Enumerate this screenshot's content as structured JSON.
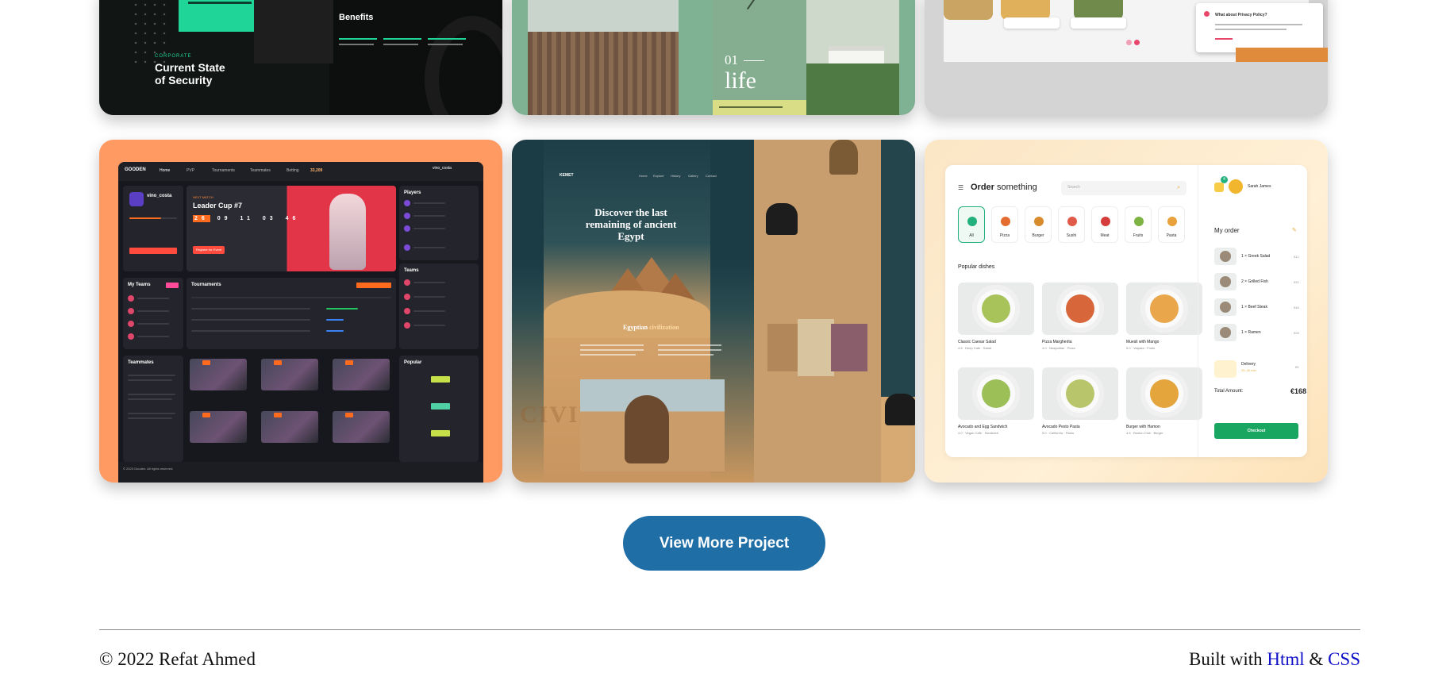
{
  "row1": {
    "security": {
      "hero_text": "Benefits",
      "kicker": "CORPORATE",
      "title_line1": "Current State",
      "title_line2": "of Security"
    },
    "architecture": {
      "number": "01",
      "word": "life"
    },
    "food_privacy": {
      "modal_title": "What about Privacy Policy?"
    }
  },
  "gaming": {
    "logo": "GOODEN",
    "nav": [
      "Home",
      "PVP",
      "Tournaments",
      "Teammates",
      "Betting"
    ],
    "points": "33,209",
    "username": "vino_costa",
    "banner_kicker": "NEXT MATCH",
    "banner_title": "Leader Cup #7",
    "countdown": [
      "26",
      "09",
      "11",
      "03",
      "46"
    ],
    "register": "Register for Event",
    "my_teams": "My Teams",
    "tournaments": "Tournaments",
    "players": "Players",
    "teams": "Teams",
    "teammates": "Teammates",
    "popular": "Popular",
    "footer": "© 2023 Gooden. All rights reserved."
  },
  "egypt": {
    "brand": "KEMET",
    "nav": [
      "Home",
      "Explore",
      "History",
      "Gallery",
      "Contact"
    ],
    "headline": "Discover the last remaining of ancient Egypt",
    "sub_a": "Egyptian",
    "sub_b": "civilization",
    "watermark": "CIVILIZATION"
  },
  "order": {
    "title_bold": "Order",
    "title_rest": "something",
    "search_placeholder": "Search",
    "categories": [
      {
        "label": "All",
        "color": "#22b07d"
      },
      {
        "label": "Pizza",
        "color": "#e46c2f"
      },
      {
        "label": "Burger",
        "color": "#d88b2c"
      },
      {
        "label": "Sushi",
        "color": "#e05a4a"
      },
      {
        "label": "Meat",
        "color": "#d63c3c"
      },
      {
        "label": "Fruits",
        "color": "#7cb342"
      },
      {
        "label": "Pasta",
        "color": "#e9a23b"
      }
    ],
    "popular": "Popular dishes",
    "dishes": [
      {
        "name": "Classic Caesar Salad",
        "meta": "4.5 · Deep Cafe · Salad",
        "color": "#a7c35a"
      },
      {
        "name": "Pizza Margherita",
        "meta": "4.0 · Neapolitan · Pizza",
        "color": "#d7673a"
      },
      {
        "name": "Muesli with Mango",
        "meta": "5.0 · Valpara · Fruits",
        "color": "#e9a64a"
      },
      {
        "name": "Avocado and Egg Sandwich",
        "meta": "4.0 · Vegan Cafe · Sandwich",
        "color": "#9cbf58"
      },
      {
        "name": "Avocado Pesto Pasta",
        "meta": "5.0 · California · Pasta",
        "color": "#b9c56a"
      },
      {
        "name": "Burger with Hamon",
        "meta": "4.5 · Boston Club · Burger",
        "color": "#e3a53c"
      }
    ],
    "user": "Sarah James",
    "notifications": "4",
    "my_order": "My order",
    "items": [
      {
        "name": "1 × Greek Salad",
        "price": "€12"
      },
      {
        "name": "2 × Grilled Fish",
        "price": "€32"
      },
      {
        "name": "1 × Beef Steak",
        "price": "€48"
      },
      {
        "name": "1 × Ramen",
        "price": "€28"
      }
    ],
    "delivery": "Delivery",
    "delivery_time": "20–40 min",
    "delivery_price": "€5",
    "total_label": "Total Amount:",
    "total_value": "€168",
    "checkout": "Checkout"
  },
  "cta": {
    "label": "View More Project"
  },
  "footer": {
    "copyright": "© 2022 Refat Ahmed",
    "built_prefix": "Built with",
    "html_link": "Html",
    "amp": "&",
    "css_link": "CSS"
  }
}
